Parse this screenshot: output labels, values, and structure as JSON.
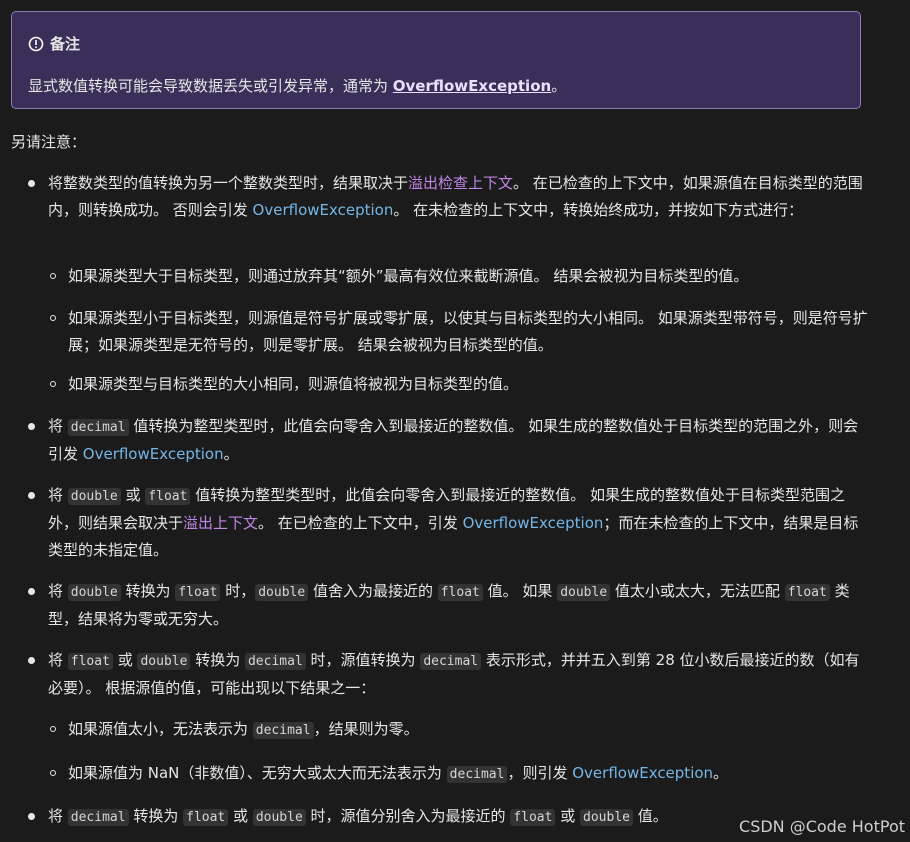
{
  "note": {
    "title": "备注",
    "text_before": "显式数值转换可能会导致数据丢失或引发异常，通常为 ",
    "link": "OverflowException",
    "text_after": "。"
  },
  "intro": "另请注意：",
  "items": {
    "i1": {
      "t1": "将整数类型的值转换为另一个整数类型时，结果取决于",
      "link1": "溢出检查上下文",
      "t2": "。 在已检查的上下文中，如果源值在目标类型的范围内，则转换成功。 否则会引发 ",
      "link2": "OverflowException",
      "t3": "。 在未检查的上下文中，转换始终成功，并按如下方式进行："
    },
    "s1": "如果源类型大于目标类型，则通过放弃其“额外”最高有效位来截断源值。 结果会被视为目标类型的值。",
    "s2": "如果源类型小于目标类型，则源值是符号扩展或零扩展，以使其与目标类型的大小相同。 如果源类型带符号，则是符号扩展；如果源类型是无符号的，则是零扩展。 结果会被视为目标类型的值。",
    "s3": "如果源类型与目标类型的大小相同，则源值将被视为目标类型的值。",
    "i2": {
      "t1": "将 ",
      "c1": "decimal",
      "t2": " 值转换为整型类型时，此值会向零舍入到最接近的整数值。 如果生成的整数值处于目标类型的范围之外，则会引发 ",
      "link": "OverflowException",
      "t3": "。"
    },
    "i3": {
      "t1": "将 ",
      "c1": "double",
      "t2": " 或 ",
      "c2": "float",
      "t3": " 值转换为整型类型时，此值会向零舍入到最接近的整数值。 如果生成的整数值处于目标类型范围之外，则结果会取决于",
      "link1": "溢出上下文",
      "t4": "。 在已检查的上下文中，引发 ",
      "link2": "OverflowException",
      "t5": "；而在未检查的上下文中，结果是目标类型的未指定值。"
    },
    "i4": {
      "t1": "将 ",
      "c1": "double",
      "t2": " 转换为 ",
      "c2": "float",
      "t3": " 时，",
      "c3": "double",
      "t4": " 值舍入为最接近的 ",
      "c4": "float",
      "t5": " 值。 如果 ",
      "c5": "double",
      "t6": " 值太小或太大，无法匹配 ",
      "c6": "float",
      "t7": " 类型，结果将为零或无穷大。"
    },
    "i5": {
      "t1": "将 ",
      "c1": "float",
      "t2": " 或 ",
      "c2": "double",
      "t3": " 转换为 ",
      "c3": "decimal",
      "t4": " 时，源值转换为 ",
      "c4": "decimal",
      "t5": " 表示形式，并并五入到第 28 位小数后最接近的数（如有必要）。 根据源值的值，可能出现以下结果之一："
    },
    "s4": {
      "t1": "如果源值太小，无法表示为 ",
      "c1": "decimal",
      "t2": "，结果则为零。"
    },
    "s5": {
      "t1": "如果源值为 NaN（非数值）、无穷大或太大而无法表示为 ",
      "c1": "decimal",
      "t2": "，则引发 ",
      "link": "OverflowException",
      "t3": "。"
    },
    "i6": {
      "t1": "将 ",
      "c1": "decimal",
      "t2": " 转换为 ",
      "c2": "float",
      "t3": " 或 ",
      "c3": "double",
      "t4": " 时，源值分别舍入为最接近的 ",
      "c4": "float",
      "t5": " 或 ",
      "c5": "double",
      "t6": " 值。"
    }
  },
  "watermark": "CSDN @Code HotPot",
  "colors": {
    "note_bg": "#3b2e58",
    "note_border": "#8d79c2",
    "link": "#75b6e7",
    "visited_link": "#c086e6",
    "page_bg": "#1b1b1b"
  }
}
